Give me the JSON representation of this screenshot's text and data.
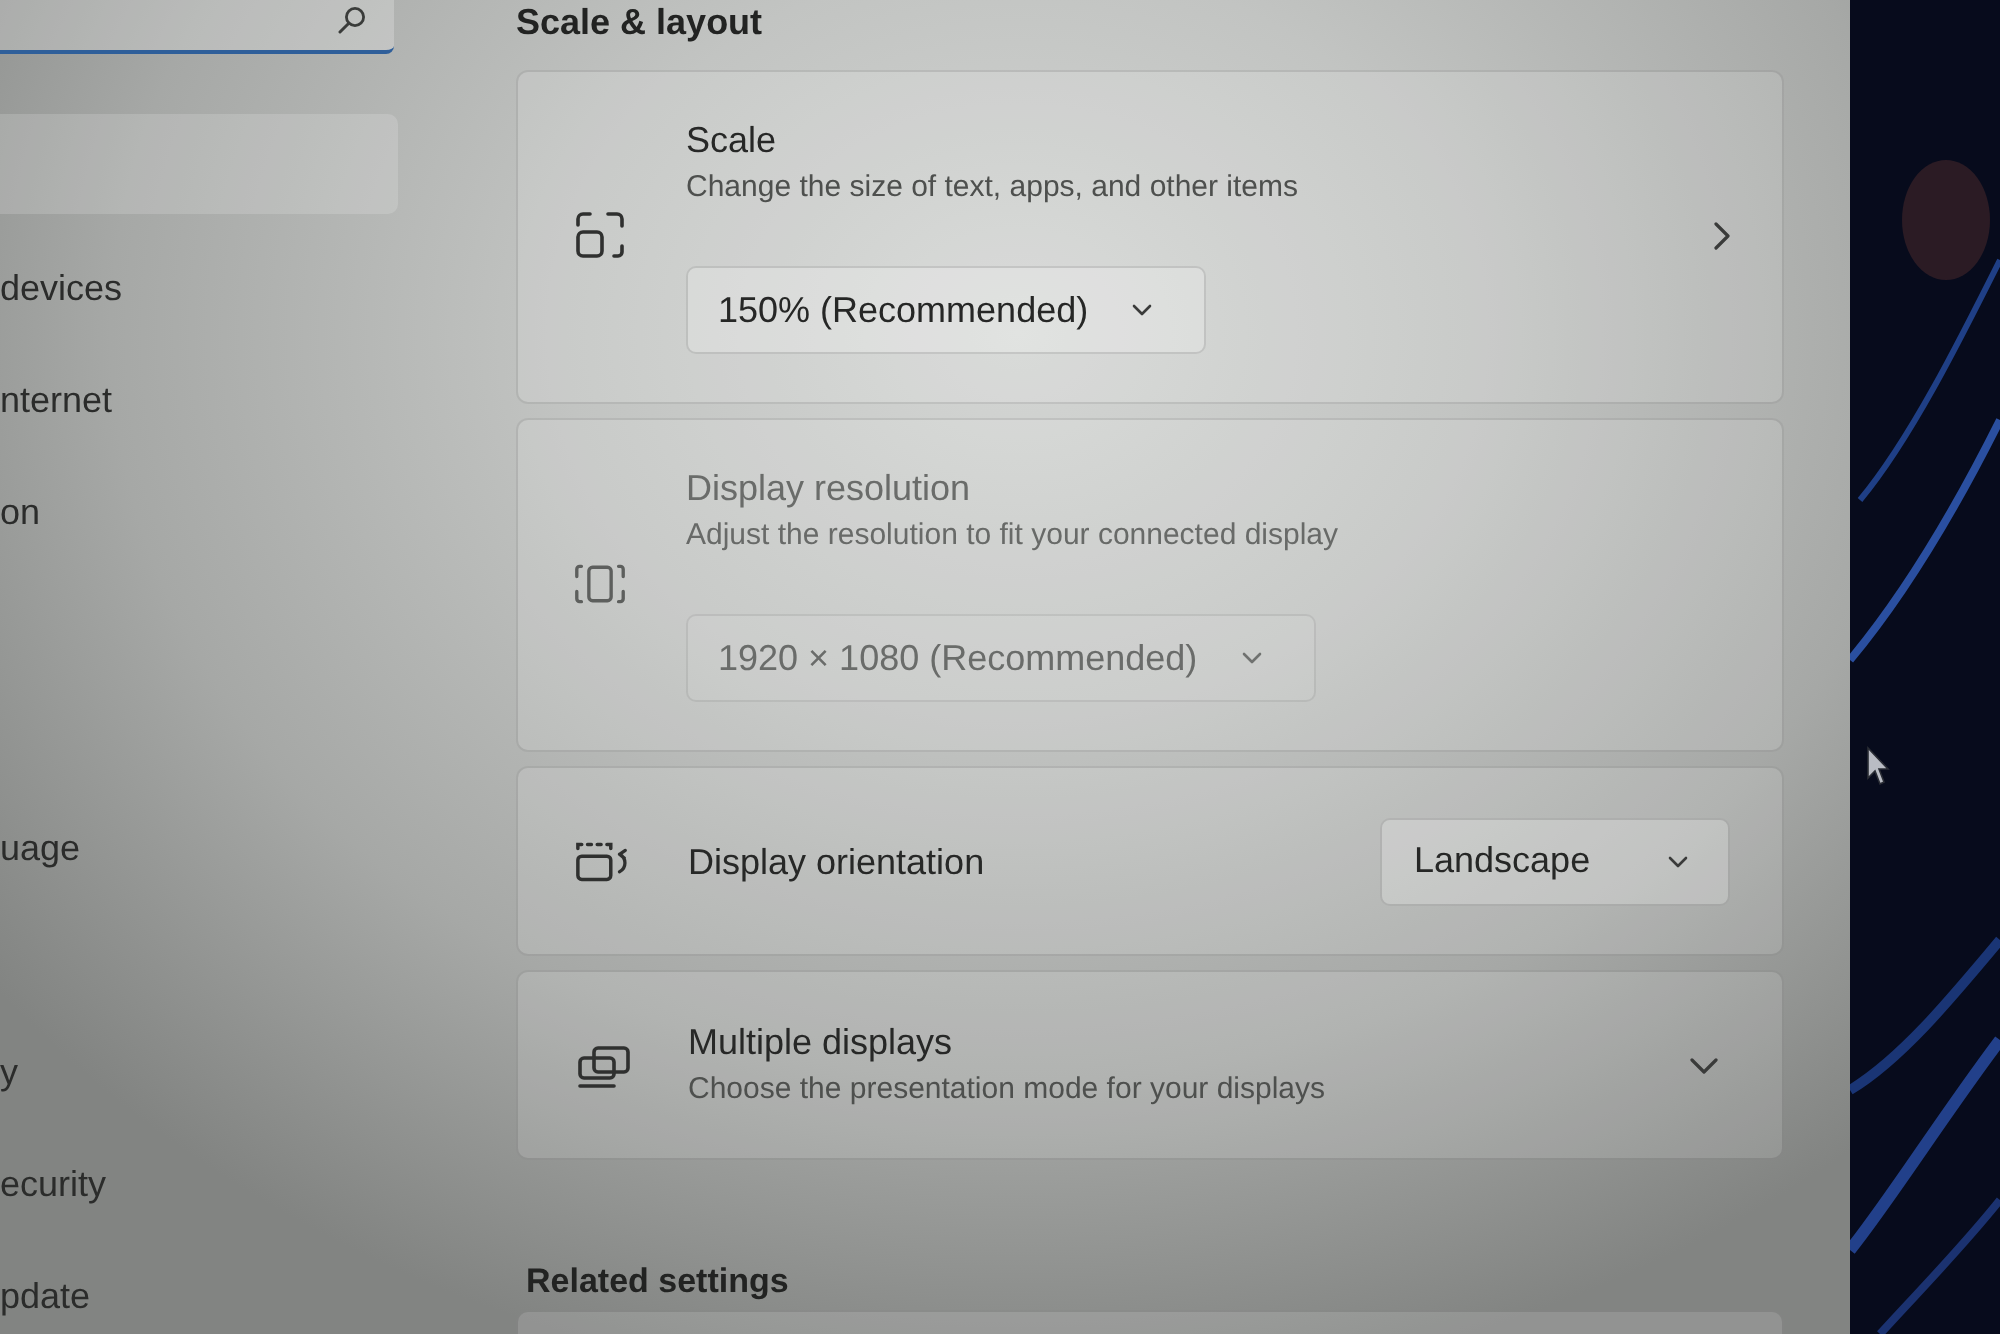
{
  "sidebar": {
    "search": {
      "focused": true
    },
    "nav_items": [
      {
        "selected": true
      },
      {
        "label": "devices",
        "selected": false
      },
      {
        "label": "nternet",
        "selected": false
      },
      {
        "label": "on",
        "selected": false
      },
      {
        "label": "uage",
        "selected": false
      },
      {
        "label": "y",
        "selected": false
      },
      {
        "label": "ecurity",
        "selected": false
      },
      {
        "label": "pdate",
        "selected": false
      }
    ]
  },
  "main": {
    "section_title": "Scale & layout",
    "cards": [
      {
        "kind": "stacked",
        "title": "Scale",
        "subtitle": "Change the size of text, apps, and other items",
        "value": "150% (Recommended)",
        "disabled": false,
        "navigable": true
      },
      {
        "kind": "stacked",
        "title": "Display resolution",
        "subtitle": "Adjust the resolution to fit your connected display",
        "value": "1920 × 1080 (Recommended)",
        "disabled": true,
        "navigable": false
      },
      {
        "kind": "inline",
        "title": "Display orientation",
        "value": "Landscape",
        "disabled": false,
        "navigable": false
      },
      {
        "kind": "expander",
        "title": "Multiple displays",
        "subtitle": "Choose the presentation mode for your displays",
        "disabled": false,
        "navigable": false,
        "expanded": false
      }
    ],
    "related_title": "Related settings"
  }
}
